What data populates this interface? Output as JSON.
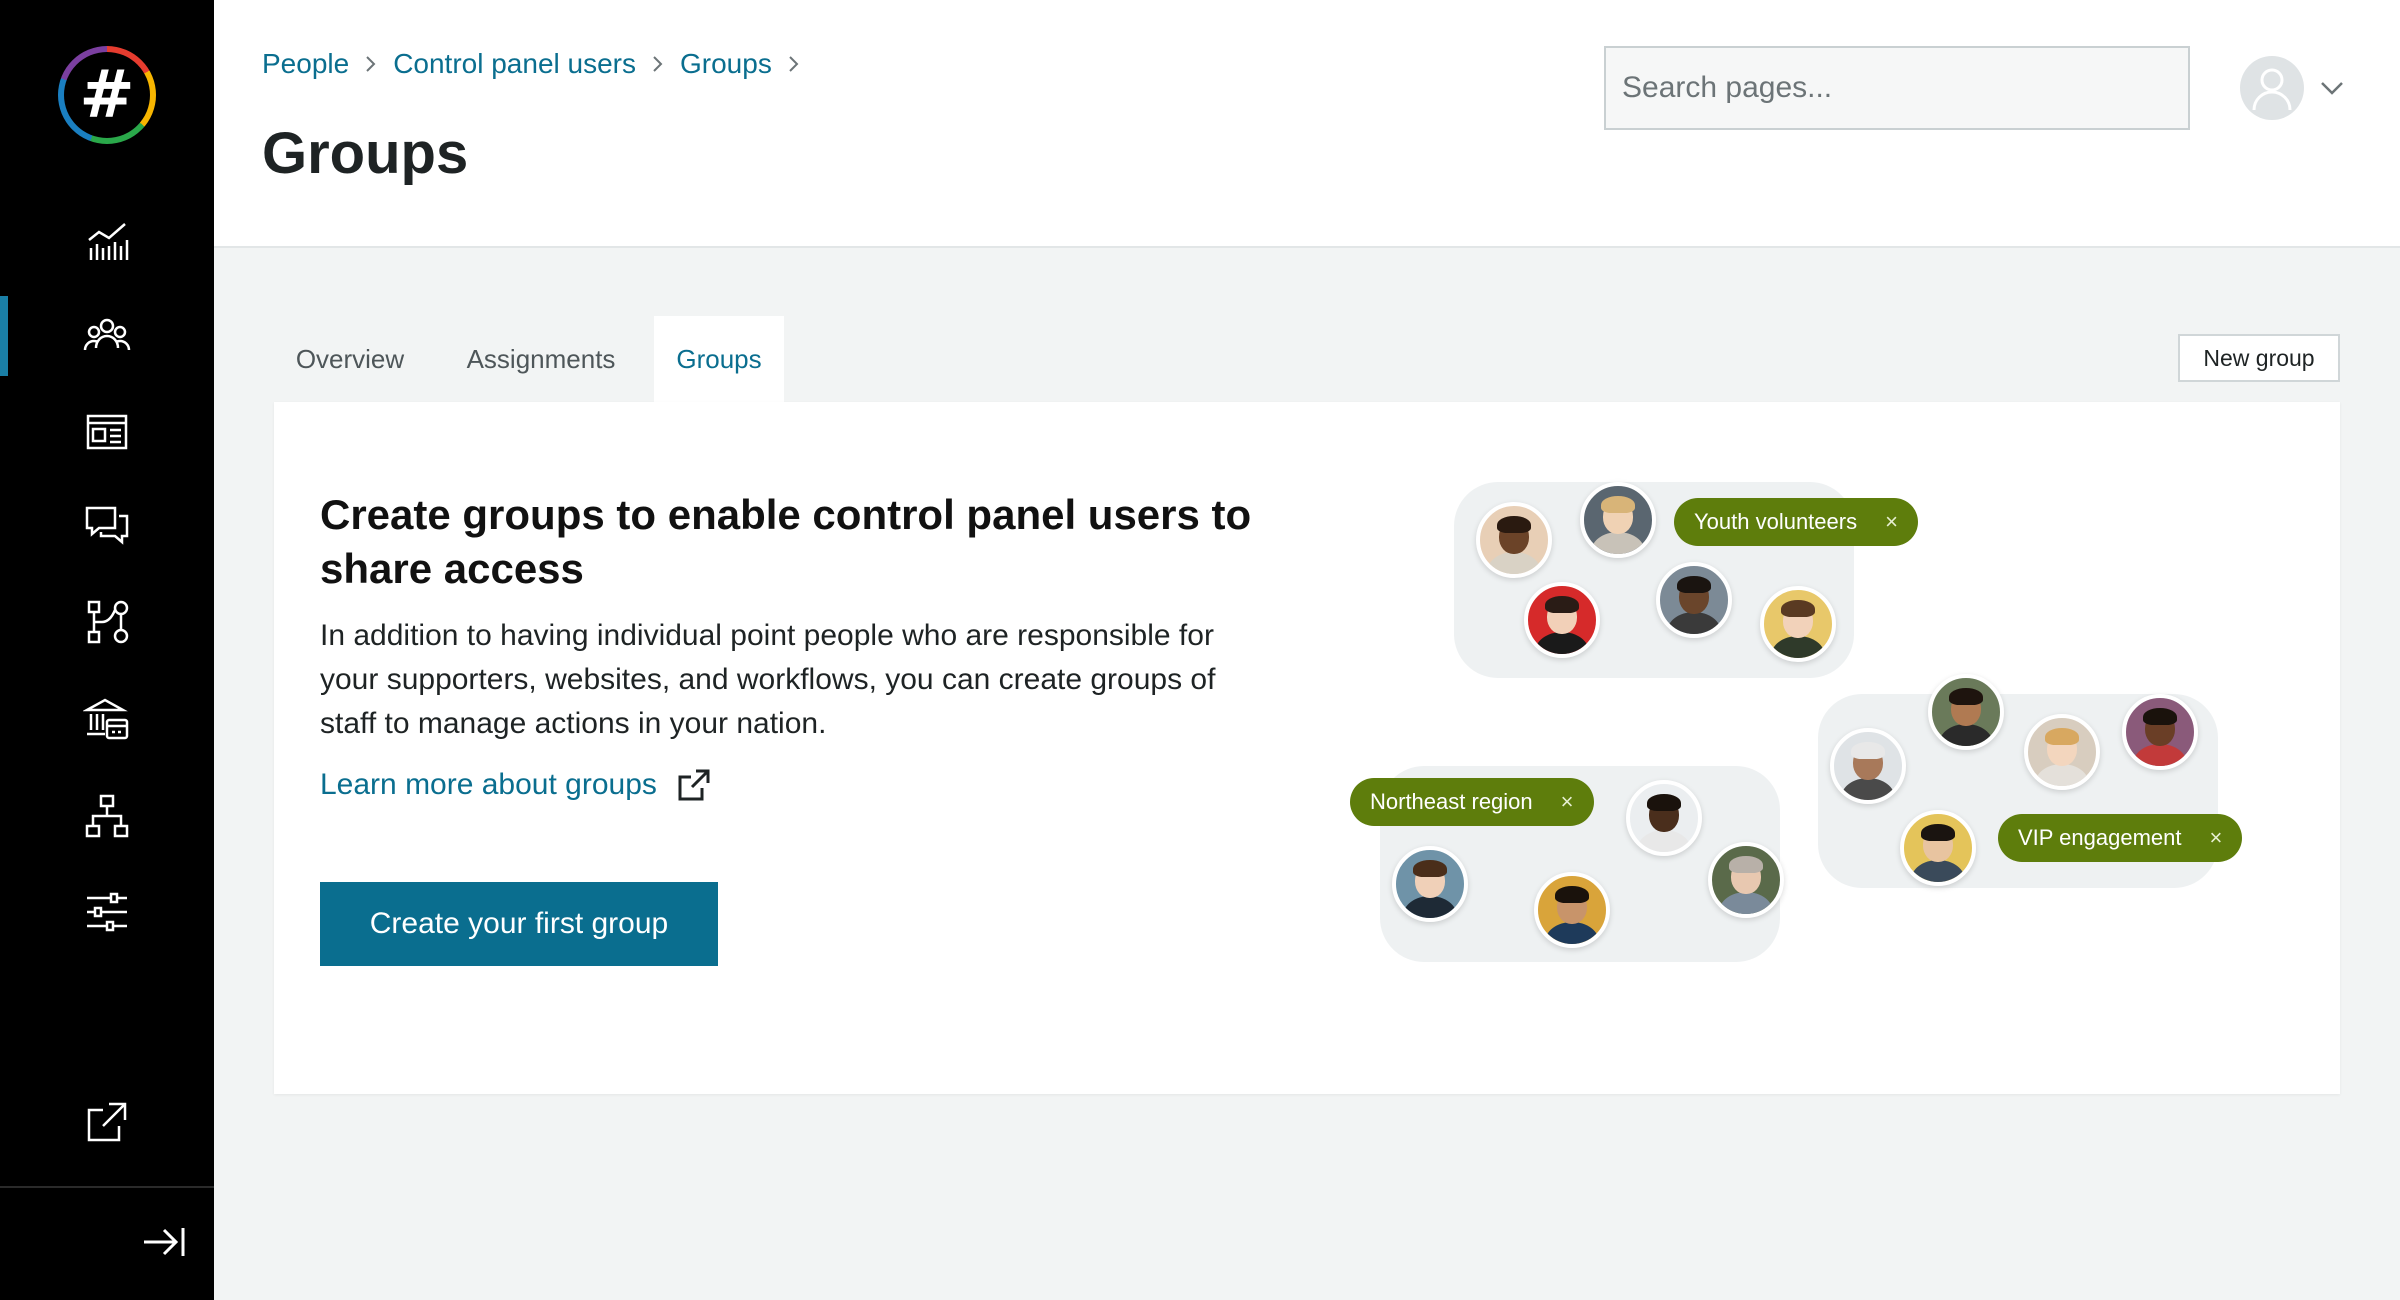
{
  "sidebar": {
    "logo_text": "#",
    "items": [
      {
        "name": "dashboard",
        "icon": "bar-chart-icon",
        "active": false
      },
      {
        "name": "people",
        "icon": "people-icon",
        "active": true
      },
      {
        "name": "websites",
        "icon": "website-icon",
        "active": false
      },
      {
        "name": "communications",
        "icon": "chat-icon",
        "active": false
      },
      {
        "name": "workflows",
        "icon": "workflow-icon",
        "active": false
      },
      {
        "name": "finances",
        "icon": "bank-icon",
        "active": false
      },
      {
        "name": "organization",
        "icon": "org-chart-icon",
        "active": false
      },
      {
        "name": "settings",
        "icon": "sliders-icon",
        "active": false
      }
    ],
    "external_icon": "external-link-icon",
    "collapse_icon": "collapse-arrow-icon"
  },
  "header": {
    "breadcrumb": [
      "People",
      "Control panel users",
      "Groups"
    ],
    "title": "Groups",
    "search_placeholder": "Search pages..."
  },
  "tabs": [
    {
      "label": "Overview",
      "active": false
    },
    {
      "label": "Assignments",
      "active": false
    },
    {
      "label": "Groups",
      "active": true
    }
  ],
  "new_group_label": "New group",
  "empty_state": {
    "title": "Create groups to enable control panel users to share access",
    "description": "In addition to having individual point people who are responsible for your supporters, websites, and workflows, you can create groups of staff to manage actions in your nation.",
    "learn_link": "Learn more about groups",
    "cta_label": "Create your first group"
  },
  "illustration": {
    "tags": [
      "Youth volunteers",
      "Northeast region",
      "VIP engagement"
    ],
    "remove_glyph": "×",
    "tag_color": "#5e7d0c"
  },
  "colors": {
    "accent": "#0a6e8f",
    "sidebar_bg": "#000000",
    "page_bg": "#f2f4f4"
  }
}
